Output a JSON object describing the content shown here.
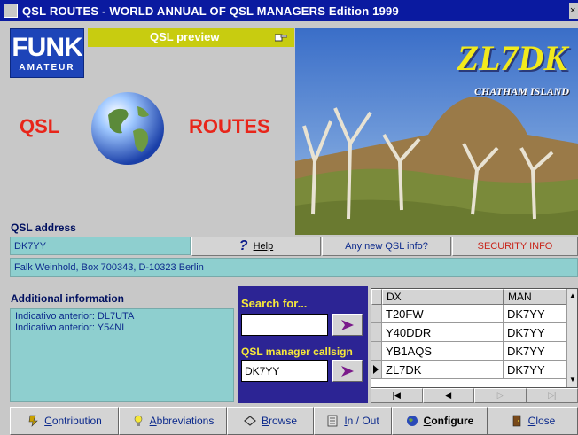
{
  "window": {
    "title": "QSL ROUTES - WORLD ANNUAL OF QSL MANAGERS Edition 1999",
    "close_glyph": "×"
  },
  "logo": {
    "line1": "FUNK",
    "line2": "AMATEUR"
  },
  "preview": {
    "label": "QSL preview"
  },
  "brand": {
    "left_word": "QSL",
    "right_word": "ROUTES"
  },
  "photo": {
    "callsign": "ZL7DK",
    "location": "CHATHAM ISLAND"
  },
  "qsl_address": {
    "label": "QSL address",
    "callsign": "DK7YY",
    "address": "Falk Weinhold, Box 700343, D-10323 Berlin"
  },
  "buttons": {
    "help": "Help",
    "new_info": "Any new QSL info?",
    "security": "SECURITY INFO"
  },
  "additional": {
    "label": "Additional information",
    "lines": [
      "Indicativo anterior: DL7UTA",
      "Indicativo anterior: Y54NL"
    ]
  },
  "search": {
    "label": "Search for...",
    "value": "",
    "manager_label": "QSL manager callsign",
    "manager_value": "DK7YY"
  },
  "grid": {
    "col_dx": "DX",
    "col_man": "MAN",
    "rows": [
      {
        "dx": "T20FW",
        "man": "DK7YY"
      },
      {
        "dx": "Y40DDR",
        "man": "DK7YY"
      },
      {
        "dx": "YB1AQS",
        "man": "DK7YY"
      },
      {
        "dx": "ZL7DK",
        "man": "DK7YY"
      }
    ],
    "selected_index": 3
  },
  "toolbar": {
    "contribution": "Contribution",
    "abbreviations": "Abbreviations",
    "browse": "Browse",
    "in_out": "In / Out",
    "configure": "Configure",
    "close": "Close"
  },
  "colors": {
    "title_bar": "#0a1aa0",
    "field_bg": "#8ecfcf",
    "search_panel": "#2c2494",
    "accent_red": "#e8251a",
    "preview_bar": "#c8cc10"
  }
}
